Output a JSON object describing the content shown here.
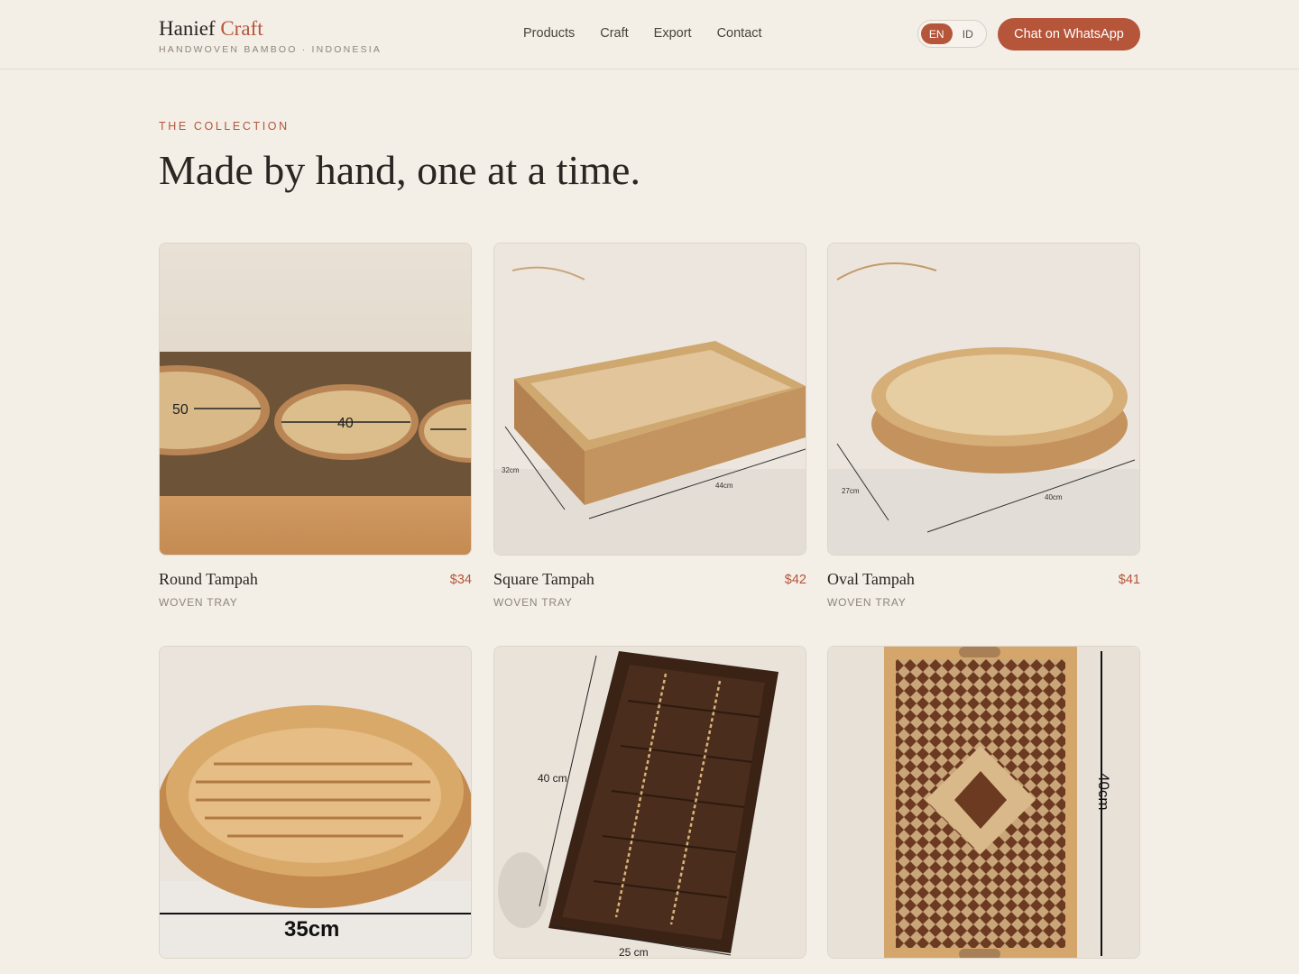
{
  "brand": {
    "name_part1": "Hanief",
    "name_part2": "Craft",
    "tagline": "HANDWOVEN BAMBOO · INDONESIA"
  },
  "nav": [
    "Products",
    "Craft",
    "Export",
    "Contact"
  ],
  "language": {
    "options": [
      "EN",
      "ID"
    ],
    "selected": "EN"
  },
  "cta_label": "Chat on WhatsApp",
  "hero": {
    "eyebrow": "THE COLLECTION",
    "headline": "Made by hand, one at a time."
  },
  "products": [
    {
      "name": "Round Tampah",
      "price": "$34",
      "type": "WOVEN TRAY",
      "labels": [
        "50",
        "40"
      ]
    },
    {
      "name": "Square Tampah",
      "price": "$42",
      "type": "WOVEN TRAY",
      "labels": [
        "32cm",
        "44cm"
      ]
    },
    {
      "name": "Oval Tampah",
      "price": "$41",
      "type": "WOVEN TRAY",
      "labels": [
        "27cm",
        "40cm"
      ]
    },
    {
      "labels": [
        "35cm"
      ]
    },
    {
      "labels": [
        "40 cm",
        "25 cm"
      ]
    },
    {
      "labels": [
        "40cm"
      ]
    }
  ],
  "colors": {
    "accent": "#b5553a",
    "background": "#f3eee6",
    "text": "#2b2622",
    "muted": "#8f857a"
  }
}
